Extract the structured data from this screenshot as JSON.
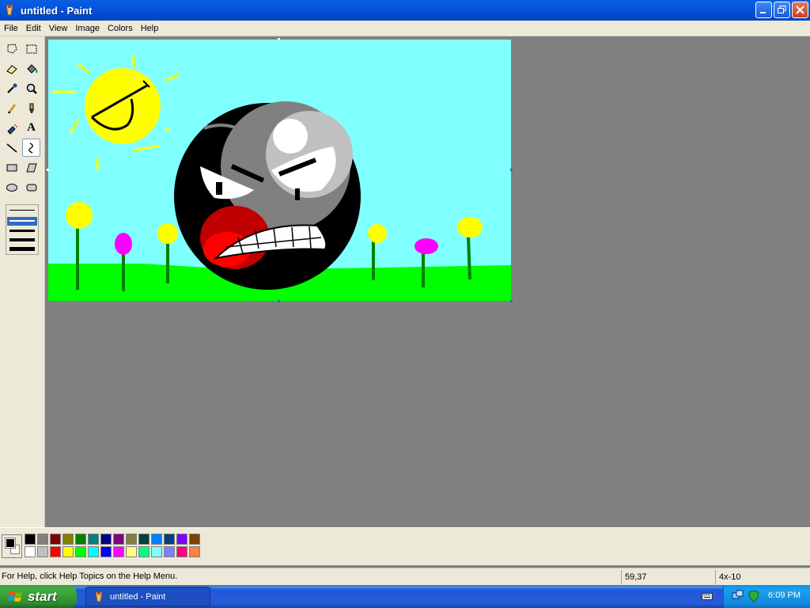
{
  "window": {
    "title": "untitled - Paint"
  },
  "menu": {
    "items": [
      "File",
      "Edit",
      "View",
      "Image",
      "Colors",
      "Help"
    ]
  },
  "toolbox": {
    "tools": [
      {
        "name": "free-form-select-tool"
      },
      {
        "name": "rectangle-select-tool"
      },
      {
        "name": "eraser-tool"
      },
      {
        "name": "fill-with-color-tool"
      },
      {
        "name": "pick-color-tool"
      },
      {
        "name": "magnifier-tool"
      },
      {
        "name": "pencil-tool"
      },
      {
        "name": "brush-tool"
      },
      {
        "name": "airbrush-tool"
      },
      {
        "name": "text-tool",
        "label": "A"
      },
      {
        "name": "line-tool"
      },
      {
        "name": "curve-tool",
        "selected": true
      },
      {
        "name": "rectangle-tool"
      },
      {
        "name": "polygon-tool"
      },
      {
        "name": "ellipse-tool"
      },
      {
        "name": "rounded-rectangle-tool"
      }
    ],
    "selected_line_width_index": 1
  },
  "palette": {
    "foreground": "#000000",
    "background": "#ffffff",
    "row1": [
      "#000000",
      "#808080",
      "#800000",
      "#808000",
      "#008000",
      "#008080",
      "#000080",
      "#800080",
      "#808040",
      "#004040",
      "#0080ff",
      "#004080",
      "#8000ff",
      "#804000"
    ],
    "row2": [
      "#ffffff",
      "#c0c0c0",
      "#ff0000",
      "#ffff00",
      "#00ff00",
      "#00ffff",
      "#0000ff",
      "#ff00ff",
      "#ffff80",
      "#00ff80",
      "#80ffff",
      "#8080ff",
      "#ff0080",
      "#ff8040"
    ]
  },
  "status": {
    "help": "For Help, click Help Topics on the Help Menu.",
    "coords": "59,37",
    "size": "4x-10"
  },
  "taskbar": {
    "start_label": "start",
    "task_label": "untitled - Paint",
    "clock": "6:09 PM"
  }
}
